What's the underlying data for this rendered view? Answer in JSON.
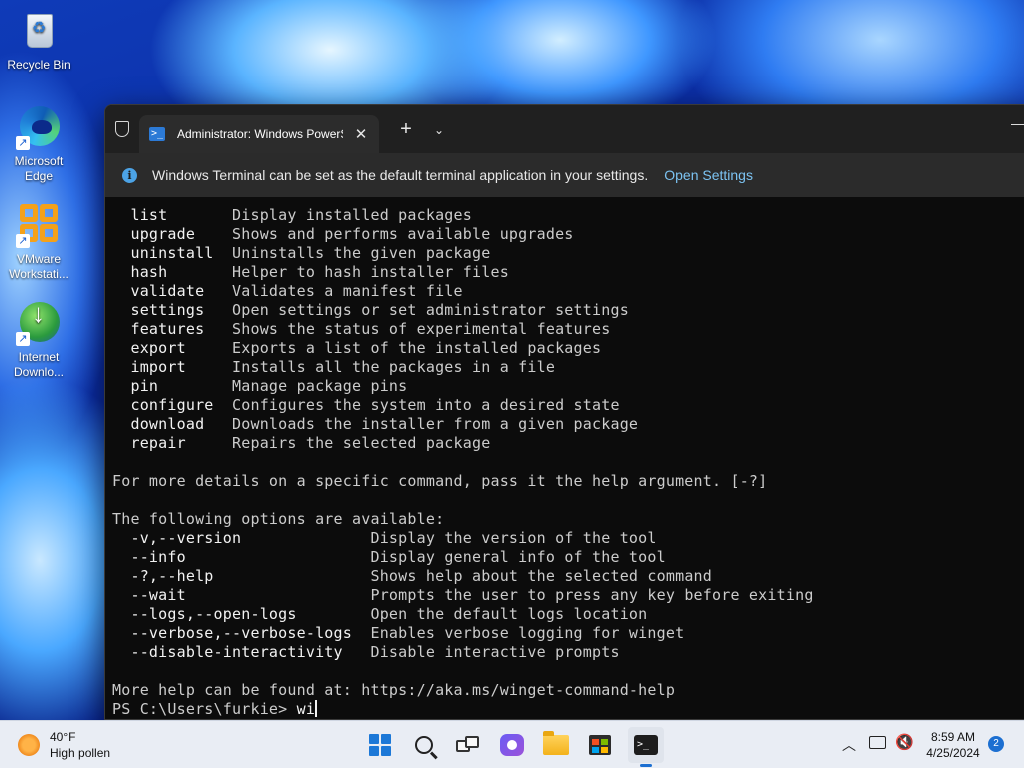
{
  "desktop": {
    "icons": [
      {
        "label": "Recycle Bin",
        "icon": "recycle-bin-icon"
      },
      {
        "label": "Microsoft Edge",
        "icon": "edge-icon"
      },
      {
        "label": "VMware Workstati...",
        "icon": "vmware-icon"
      },
      {
        "label": "Internet Downlo...",
        "icon": "idm-icon"
      }
    ]
  },
  "terminal": {
    "tab_title": "Administrator: Windows PowerShell",
    "tab_close": "✕",
    "new_tab": "+",
    "dropdown": "⌄",
    "minimize": "—",
    "info_text": "Windows Terminal can be set as the default terminal application in your settings.",
    "info_link": "Open Settings",
    "commands": [
      {
        "name": "list",
        "desc": "Display installed packages"
      },
      {
        "name": "upgrade",
        "desc": "Shows and performs available upgrades"
      },
      {
        "name": "uninstall",
        "desc": "Uninstalls the given package"
      },
      {
        "name": "hash",
        "desc": "Helper to hash installer files"
      },
      {
        "name": "validate",
        "desc": "Validates a manifest file"
      },
      {
        "name": "settings",
        "desc": "Open settings or set administrator settings"
      },
      {
        "name": "features",
        "desc": "Shows the status of experimental features"
      },
      {
        "name": "export",
        "desc": "Exports a list of the installed packages"
      },
      {
        "name": "import",
        "desc": "Installs all the packages in a file"
      },
      {
        "name": "pin",
        "desc": "Manage package pins"
      },
      {
        "name": "configure",
        "desc": "Configures the system into a desired state"
      },
      {
        "name": "download",
        "desc": "Downloads the installer from a given package"
      },
      {
        "name": "repair",
        "desc": "Repairs the selected package"
      }
    ],
    "help_hint": "For more details on a specific command, pass it the help argument. [-?]",
    "options_header": "The following options are available:",
    "options": [
      {
        "name": "-v,--version",
        "desc": "Display the version of the tool"
      },
      {
        "name": "--info",
        "desc": "Display general info of the tool"
      },
      {
        "name": "-?,--help",
        "desc": "Shows help about the selected command"
      },
      {
        "name": "--wait",
        "desc": "Prompts the user to press any key before exiting"
      },
      {
        "name": "--logs,--open-logs",
        "desc": "Open the default logs location"
      },
      {
        "name": "--verbose,--verbose-logs",
        "desc": "Enables verbose logging for winget"
      },
      {
        "name": "--disable-interactivity",
        "desc": "Disable interactive prompts"
      }
    ],
    "more_help": "More help can be found at: https://aka.ms/winget-command-help",
    "prompt": "PS C:\\Users\\furkie> ",
    "input": "wi"
  },
  "taskbar": {
    "weather_temp": "40°F",
    "weather_desc": "High pollen",
    "apps": [
      "start-button",
      "search-button",
      "task-view-button",
      "teams-meet-button",
      "file-explorer-button",
      "microsoft-store-button",
      "windows-terminal-button"
    ],
    "time": "8:59 AM",
    "date": "4/25/2024",
    "notification_count": "2",
    "tray_chevron": "︿",
    "accent": "#1c6fd1"
  }
}
